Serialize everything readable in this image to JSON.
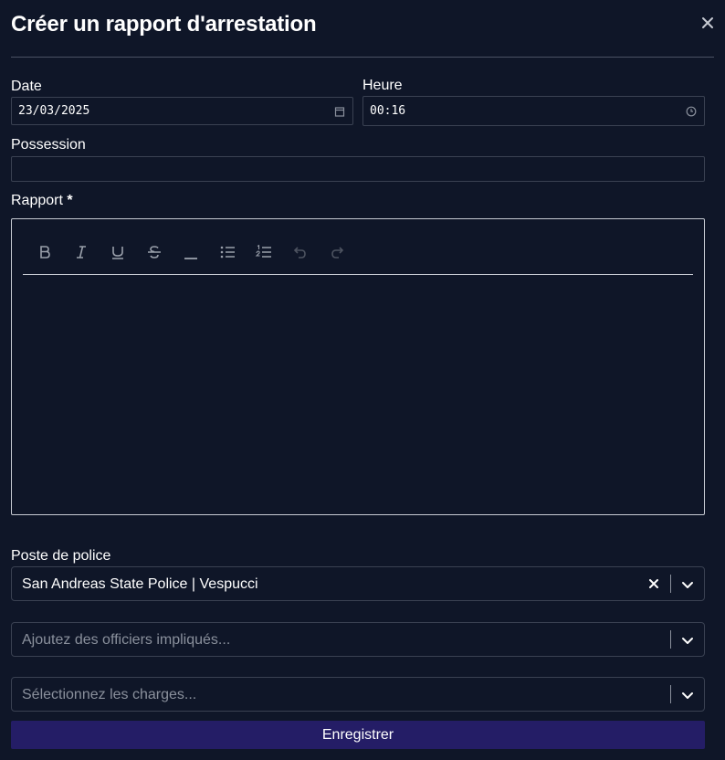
{
  "dialog": {
    "title": "Créer un rapport d'arrestation",
    "close_icon": "close-icon"
  },
  "form": {
    "date": {
      "label": "Date",
      "value": "23/03/2025",
      "icon": "calendar-icon"
    },
    "time": {
      "label": "Heure",
      "value": "00:16",
      "icon": "clock-icon"
    },
    "possession": {
      "label": "Possession",
      "value": ""
    },
    "report": {
      "label": "Rapport",
      "required_marker": "*",
      "toolbar": [
        "bold-icon",
        "italic-icon",
        "underline-icon",
        "strikethrough-icon",
        "horizontal-rule-icon",
        "bullet-list-icon",
        "ordered-list-icon",
        "undo-icon",
        "redo-icon"
      ],
      "content": ""
    },
    "police_station": {
      "label": "Poste de police",
      "value": "San Andreas State Police | Vespucci"
    },
    "officers": {
      "placeholder": "Ajoutez des officiers impliqués..."
    },
    "charges": {
      "placeholder": "Sélectionnez les charges..."
    },
    "submit_label": "Enregistrer"
  },
  "colors": {
    "background": "#0f1628",
    "border": "#3a4152",
    "editor_border": "#c7cbd3",
    "button": "#241d66",
    "placeholder": "#8a909c"
  }
}
